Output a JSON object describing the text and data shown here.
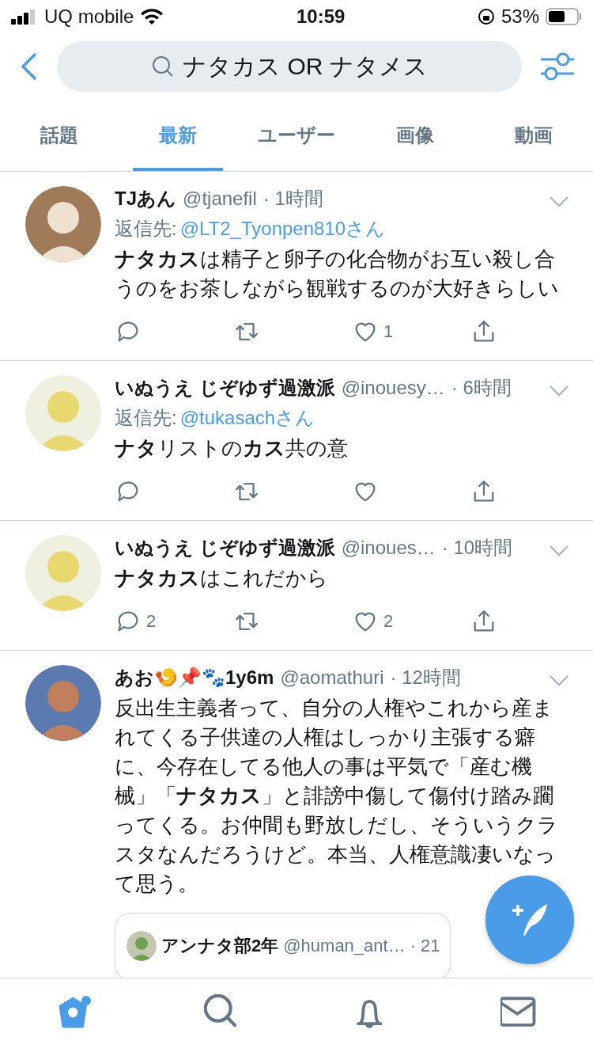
{
  "status_bar": {
    "carrier": "UQ mobile",
    "time": "10:59",
    "battery": "53%"
  },
  "search": {
    "value": "ナタカス OR ナタメス"
  },
  "tabs": [
    {
      "label": "話題",
      "selected": false
    },
    {
      "label": "最新",
      "selected": true
    },
    {
      "label": "ユーザー",
      "selected": false
    },
    {
      "label": "画像",
      "selected": false
    },
    {
      "label": "動画",
      "selected": false
    }
  ],
  "tweets": [
    {
      "name": "TJあん",
      "handle": "@tjanefil",
      "time": "· 1時間",
      "reply_to": {
        "label": "返信先:",
        "target": "@LT2_Tyonpen810さん"
      },
      "body": "**ナタカス**は精子と卵子の化合物がお互い殺し合うのをお茶しながら観戦するのが大好きらしい",
      "like_count": "1"
    },
    {
      "name": "いぬうえ じぞゆず過激派",
      "handle": "@inouesy…",
      "time": "· 6時間",
      "reply_to": {
        "label": "返信先:",
        "target": "@tukasachさん"
      },
      "body": "**ナタ**リストの**カス**共の意"
    },
    {
      "name": "いぬうえ じぞゆず過激派",
      "handle": "@inoues…",
      "time": "· 10時間",
      "body": "**ナタカス**はこれだから",
      "reply_count": "2",
      "like_count": "2"
    },
    {
      "name": "あお🍤📌🐾1y6m",
      "handle": "@aomathuri",
      "time": "· 12時間",
      "body": "反出生主義者って、自分の人権やこれから産まれてくる子供達の人権はしっかり主張する癖に、今存在してる他人の事は平気で「産む機械」「**ナタカス**」と誹謗中傷して傷付け踏み躙ってくる。お仲間も野放しだし、そういうクラスタなんだろうけど。本当、人権意識凄いなって思う。",
      "quote": {
        "name": "アンナタ部2年",
        "handle": "@human_ant…",
        "time": "· 21"
      }
    }
  ],
  "nav": [
    {
      "kind": "home",
      "selected": true,
      "badge": true
    },
    {
      "kind": "search",
      "selected": false,
      "badge": false
    },
    {
      "kind": "bell",
      "selected": false,
      "badge": false
    },
    {
      "kind": "mail",
      "selected": false,
      "badge": false
    }
  ]
}
